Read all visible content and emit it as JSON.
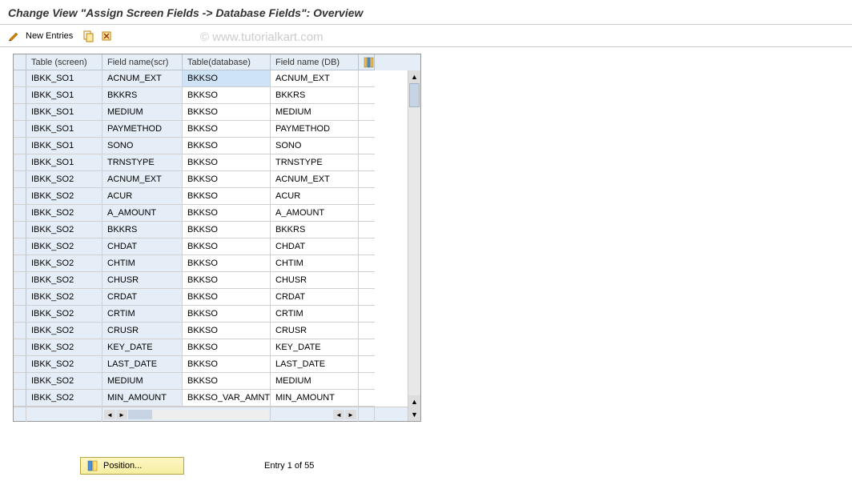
{
  "title": "Change View \"Assign Screen Fields -> Database Fields\": Overview",
  "toolbar": {
    "new_entries_label": "New Entries"
  },
  "watermark": "© www.tutorialkart.com",
  "columns": {
    "c0": "Table (screen)",
    "c1": "Field name(scr)",
    "c2": "Table(database)",
    "c3": "Field name (DB)"
  },
  "rows": [
    {
      "t": "IBKK_SO1",
      "f": "ACNUM_EXT",
      "td": "BKKSO",
      "fd": "ACNUM_EXT",
      "sel": true
    },
    {
      "t": "IBKK_SO1",
      "f": "BKKRS",
      "td": "BKKSO",
      "fd": "BKKRS"
    },
    {
      "t": "IBKK_SO1",
      "f": "MEDIUM",
      "td": "BKKSO",
      "fd": "MEDIUM"
    },
    {
      "t": "IBKK_SO1",
      "f": "PAYMETHOD",
      "td": "BKKSO",
      "fd": "PAYMETHOD"
    },
    {
      "t": "IBKK_SO1",
      "f": "SONO",
      "td": "BKKSO",
      "fd": "SONO"
    },
    {
      "t": "IBKK_SO1",
      "f": "TRNSTYPE",
      "td": "BKKSO",
      "fd": "TRNSTYPE"
    },
    {
      "t": "IBKK_SO2",
      "f": "ACNUM_EXT",
      "td": "BKKSO",
      "fd": "ACNUM_EXT"
    },
    {
      "t": "IBKK_SO2",
      "f": "ACUR",
      "td": "BKKSO",
      "fd": "ACUR"
    },
    {
      "t": "IBKK_SO2",
      "f": "A_AMOUNT",
      "td": "BKKSO",
      "fd": "A_AMOUNT"
    },
    {
      "t": "IBKK_SO2",
      "f": "BKKRS",
      "td": "BKKSO",
      "fd": "BKKRS"
    },
    {
      "t": "IBKK_SO2",
      "f": "CHDAT",
      "td": "BKKSO",
      "fd": "CHDAT"
    },
    {
      "t": "IBKK_SO2",
      "f": "CHTIM",
      "td": "BKKSO",
      "fd": "CHTIM"
    },
    {
      "t": "IBKK_SO2",
      "f": "CHUSR",
      "td": "BKKSO",
      "fd": "CHUSR"
    },
    {
      "t": "IBKK_SO2",
      "f": "CRDAT",
      "td": "BKKSO",
      "fd": "CRDAT"
    },
    {
      "t": "IBKK_SO2",
      "f": "CRTIM",
      "td": "BKKSO",
      "fd": "CRTIM"
    },
    {
      "t": "IBKK_SO2",
      "f": "CRUSR",
      "td": "BKKSO",
      "fd": "CRUSR"
    },
    {
      "t": "IBKK_SO2",
      "f": "KEY_DATE",
      "td": "BKKSO",
      "fd": "KEY_DATE"
    },
    {
      "t": "IBKK_SO2",
      "f": "LAST_DATE",
      "td": "BKKSO",
      "fd": "LAST_DATE"
    },
    {
      "t": "IBKK_SO2",
      "f": "MEDIUM",
      "td": "BKKSO",
      "fd": "MEDIUM"
    },
    {
      "t": "IBKK_SO2",
      "f": "MIN_AMOUNT",
      "td": "BKKSO_VAR_AMNT",
      "fd": "MIN_AMOUNT"
    }
  ],
  "footer": {
    "position_label": "Position...",
    "entry_label": "Entry 1 of 55"
  }
}
